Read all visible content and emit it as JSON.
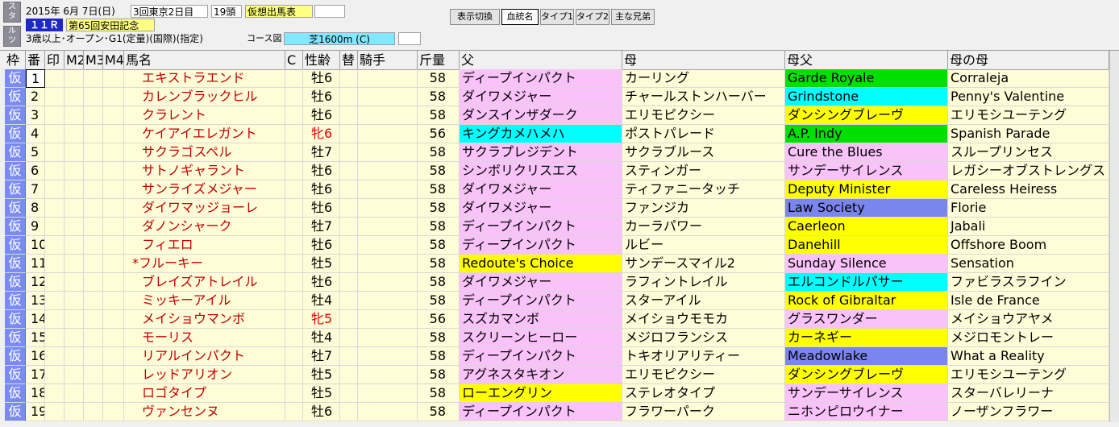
{
  "header": {
    "side_top": "ス\nタ",
    "side_bottom": "ル\nツ",
    "date": "2015年 6月 7日(日)",
    "meeting": "3回東京2日目",
    "runners": "19頭",
    "mode_badge": "仮想出馬表",
    "race_no": "１１Ｒ",
    "race_name": "第65回安田記念",
    "conditions": "3歳以上･オープン･G1(定量)(国際)(指定)",
    "course_label": "コース図",
    "course": "芝1600m (C)"
  },
  "toolbar": {
    "buttons": [
      {
        "label": "表示切換"
      },
      {
        "label": "血統名"
      },
      {
        "label": "タイプ1"
      },
      {
        "label": "タイプ2"
      },
      {
        "label": "主な兄弟"
      }
    ]
  },
  "columns": [
    "枠",
    "番",
    "印",
    "M2",
    "M3",
    "M4",
    "馬名",
    "C",
    "性齢",
    "替",
    "騎手",
    "斤量",
    "父",
    "母",
    "母父",
    "母の母"
  ],
  "colors": {
    "pink": "#f9c2f9",
    "yellow": "#ffff00",
    "green": "#00e000",
    "cyan": "#00ffff",
    "blue": "#7b85ee",
    "row_bg": "#fffdd8",
    "waku": "#7b8cf0"
  },
  "rows": [
    {
      "waku": "仮",
      "no": "1",
      "name": "エキストラエンド",
      "sex": "牡6",
      "sex_red": false,
      "kin": "58",
      "sire": "ディープインパクト",
      "sire_c": "pink",
      "dam": "カーリング",
      "bms": "Garde Royale",
      "bms_c": "green",
      "damdam": "Corraleja"
    },
    {
      "waku": "仮",
      "no": "2",
      "name": "カレンブラックヒル",
      "sex": "牡6",
      "sex_red": false,
      "kin": "58",
      "sire": "ダイワメジャー",
      "sire_c": "pink",
      "dam": "チャールストンハーバー",
      "bms": "Grindstone",
      "bms_c": "cyan",
      "damdam": "Penny's Valentine"
    },
    {
      "waku": "仮",
      "no": "3",
      "name": "クラレント",
      "sex": "牡6",
      "sex_red": false,
      "kin": "58",
      "sire": "ダンスインザダーク",
      "sire_c": "pink",
      "dam": "エリモピクシー",
      "bms": "ダンシングブレーヴ",
      "bms_c": "yellow",
      "damdam": "エリモシユーテング"
    },
    {
      "waku": "仮",
      "no": "4",
      "name": "ケイアイエレガント",
      "sex": "牝6",
      "sex_red": true,
      "kin": "56",
      "sire": "キングカメハメハ",
      "sire_c": "cyan",
      "dam": "ポストパレード",
      "bms": "A.P. Indy",
      "bms_c": "green",
      "damdam": "Spanish Parade"
    },
    {
      "waku": "仮",
      "no": "5",
      "name": "サクラゴスペル",
      "sex": "牡7",
      "sex_red": false,
      "kin": "58",
      "sire": "サクラプレジデント",
      "sire_c": "pink",
      "dam": "サクラブルース",
      "bms": "Cure the Blues",
      "bms_c": "pink",
      "damdam": "スループリンセス"
    },
    {
      "waku": "仮",
      "no": "6",
      "name": "サトノギャラント",
      "sex": "牡6",
      "sex_red": false,
      "kin": "58",
      "sire": "シンボリクリスエス",
      "sire_c": "pink",
      "dam": "スティンガー",
      "bms": "サンデーサイレンス",
      "bms_c": "pink",
      "damdam": "レガシーオブストレングス"
    },
    {
      "waku": "仮",
      "no": "7",
      "name": "サンライズメジャー",
      "sex": "牡6",
      "sex_red": false,
      "kin": "58",
      "sire": "ダイワメジャー",
      "sire_c": "pink",
      "dam": "ティファニータッチ",
      "bms": "Deputy Minister",
      "bms_c": "yellow",
      "damdam": "Careless Heiress"
    },
    {
      "waku": "仮",
      "no": "8",
      "name": "ダイワマッジョーレ",
      "sex": "牡6",
      "sex_red": false,
      "kin": "58",
      "sire": "ダイワメジャー",
      "sire_c": "pink",
      "dam": "ファンジカ",
      "bms": "Law Society",
      "bms_c": "blue",
      "damdam": "Florie"
    },
    {
      "waku": "仮",
      "no": "9",
      "name": "ダノンシャーク",
      "sex": "牡7",
      "sex_red": false,
      "kin": "58",
      "sire": "ディープインパクト",
      "sire_c": "pink",
      "dam": "カーラパワー",
      "bms": "Caerleon",
      "bms_c": "yellow",
      "damdam": "Jabali"
    },
    {
      "waku": "仮",
      "no": "10",
      "name": "フィエロ",
      "sex": "牡6",
      "sex_red": false,
      "kin": "58",
      "sire": "ディープインパクト",
      "sire_c": "pink",
      "dam": "ルビー",
      "bms": "Danehill",
      "bms_c": "yellow",
      "damdam": "Offshore Boom"
    },
    {
      "waku": "仮",
      "no": "11",
      "name": "*フルーキー",
      "sex": "牡5",
      "sex_red": false,
      "kin": "58",
      "sire": "Redoute's Choice",
      "sire_c": "yellow",
      "dam": "サンデースマイル2",
      "bms": "Sunday Silence",
      "bms_c": "pink",
      "damdam": "Sensation"
    },
    {
      "waku": "仮",
      "no": "12",
      "name": "ブレイズアトレイル",
      "sex": "牡6",
      "sex_red": false,
      "kin": "58",
      "sire": "ダイワメジャー",
      "sire_c": "pink",
      "dam": "ラフィントレイル",
      "bms": "エルコンドルパサー",
      "bms_c": "cyan",
      "damdam": "ファビラスラフイン"
    },
    {
      "waku": "仮",
      "no": "13",
      "name": "ミッキーアイル",
      "sex": "牡4",
      "sex_red": false,
      "kin": "58",
      "sire": "ディープインパクト",
      "sire_c": "pink",
      "dam": "スターアイル",
      "bms": "Rock of Gibraltar",
      "bms_c": "yellow",
      "damdam": "Isle de France"
    },
    {
      "waku": "仮",
      "no": "14",
      "name": "メイショウマンボ",
      "sex": "牝5",
      "sex_red": true,
      "kin": "56",
      "sire": "スズカマンボ",
      "sire_c": "pink",
      "dam": "メイショウモモカ",
      "bms": "グラスワンダー",
      "bms_c": "pink",
      "damdam": "メイショウアヤメ"
    },
    {
      "waku": "仮",
      "no": "15",
      "name": "モーリス",
      "sex": "牡4",
      "sex_red": false,
      "kin": "58",
      "sire": "スクリーンヒーロー",
      "sire_c": "pink",
      "dam": "メジロフランシス",
      "bms": "カーネギー",
      "bms_c": "yellow",
      "damdam": "メジロモントレー"
    },
    {
      "waku": "仮",
      "no": "16",
      "name": "リアルインパクト",
      "sex": "牡7",
      "sex_red": false,
      "kin": "58",
      "sire": "ディープインパクト",
      "sire_c": "pink",
      "dam": "トキオリアリティー",
      "bms": "Meadowlake",
      "bms_c": "blue",
      "damdam": "What a Reality"
    },
    {
      "waku": "仮",
      "no": "17",
      "name": "レッドアリオン",
      "sex": "牡5",
      "sex_red": false,
      "kin": "58",
      "sire": "アグネスタキオン",
      "sire_c": "pink",
      "dam": "エリモピクシー",
      "bms": "ダンシングブレーヴ",
      "bms_c": "yellow",
      "damdam": "エリモシユーテング"
    },
    {
      "waku": "仮",
      "no": "18",
      "name": "ロゴタイプ",
      "sex": "牡5",
      "sex_red": false,
      "kin": "58",
      "sire": "ローエングリン",
      "sire_c": "yellow",
      "dam": "ステレオタイプ",
      "bms": "サンデーサイレンス",
      "bms_c": "pink",
      "damdam": "スターバレリーナ"
    },
    {
      "waku": "仮",
      "no": "19",
      "name": "ヴァンセンヌ",
      "sex": "牡6",
      "sex_red": false,
      "kin": "58",
      "sire": "ディープインパクト",
      "sire_c": "pink",
      "dam": "フラワーパーク",
      "bms": "ニホンピロウイナー",
      "bms_c": "pink",
      "damdam": "ノーザンフラワー"
    }
  ]
}
